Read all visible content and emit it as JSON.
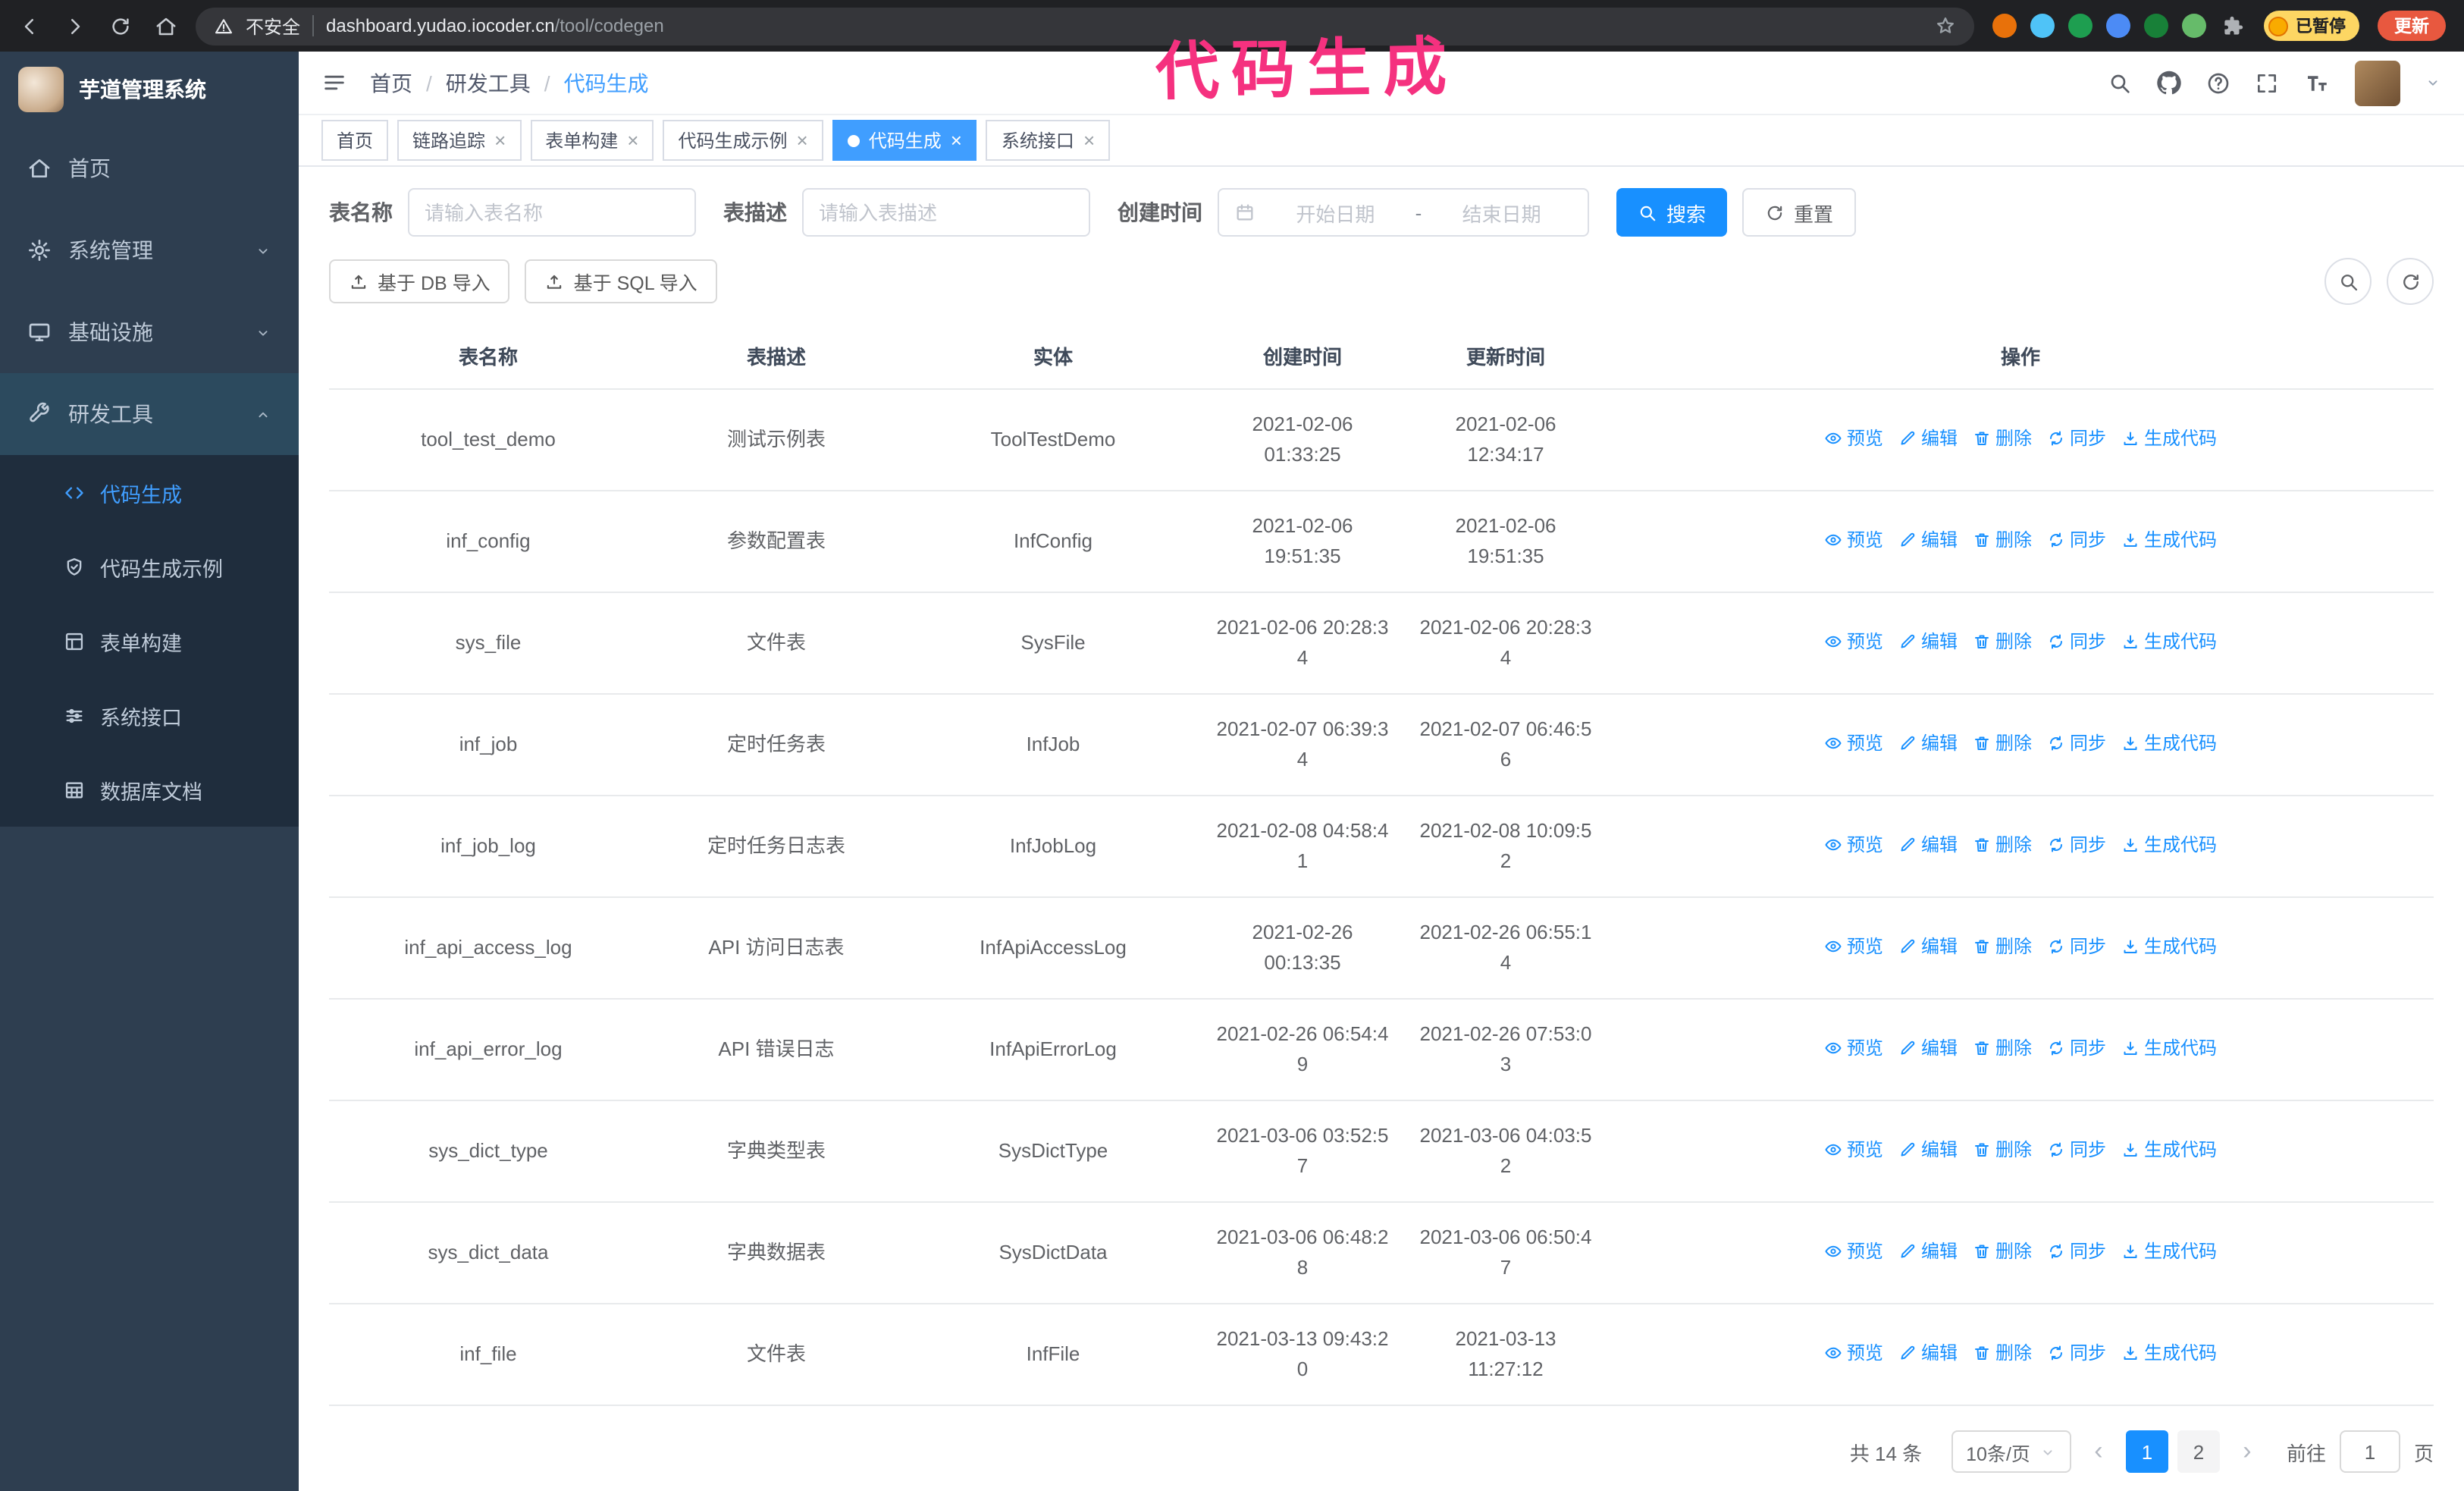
{
  "colors": {
    "primary": "#1890ff",
    "tab_active": "#409eff",
    "sidebar_bg": "#2e3e50",
    "submenu_bg": "#1f2d3d",
    "sidebar_active": "#409eff",
    "annotation": "#f5317f",
    "update_btn": "#e8583f",
    "paused_bg": "#fdd663"
  },
  "browser": {
    "security_label": "不安全",
    "url_host": "dashboard.yudao.iocoder.cn",
    "url_path": "/tool/codegen",
    "paused_badge": "已暂停",
    "update_button": "更新",
    "extensions": [
      {
        "name": "extension-icon",
        "type": "circle",
        "color": "#e8710a"
      },
      {
        "name": "extension-icon",
        "type": "circle",
        "color": "#4fc3f7"
      },
      {
        "name": "extension-icon",
        "type": "circle",
        "color": "#1e9e50"
      },
      {
        "name": "extension-icon",
        "type": "circle",
        "color": "#4c8bf5"
      },
      {
        "name": "extension-icon",
        "type": "circle",
        "color": "#188038"
      },
      {
        "name": "extension-icon",
        "type": "circle",
        "color": "#66bb6a"
      },
      {
        "name": "puzzle-extension-icon",
        "type": "puzzle",
        "color": "#aeb1b5"
      }
    ]
  },
  "annotation": {
    "text": "代码生成"
  },
  "sidebar": {
    "logo_title": "芋道管理系统",
    "items": [
      {
        "id": "home",
        "label": "首页",
        "icon": "home"
      },
      {
        "id": "system",
        "label": "系统管理",
        "icon": "gear",
        "chevron": "down"
      },
      {
        "id": "infra",
        "label": "基础设施",
        "icon": "monitor",
        "chevron": "down"
      },
      {
        "id": "devtools",
        "label": "研发工具",
        "icon": "tools",
        "chevron": "up",
        "expanded": true
      }
    ],
    "subitems": [
      {
        "id": "codegen",
        "label": "代码生成",
        "icon": "code",
        "active": true
      },
      {
        "id": "codegen-example",
        "label": "代码生成示例",
        "icon": "shield",
        "active": false
      },
      {
        "id": "form-builder",
        "label": "表单构建",
        "icon": "form",
        "active": false
      },
      {
        "id": "system-api",
        "label": "系统接口",
        "icon": "api",
        "active": false
      },
      {
        "id": "db-doc",
        "label": "数据库文档",
        "icon": "dbtable",
        "active": false
      }
    ]
  },
  "header": {
    "breadcrumb": [
      "首页",
      "研发工具",
      "代码生成"
    ]
  },
  "tabs": [
    {
      "id": "home",
      "label": "首页",
      "closable": false,
      "active": false
    },
    {
      "id": "tracer",
      "label": "链路追踪",
      "closable": true,
      "active": false
    },
    {
      "id": "form-builder",
      "label": "表单构建",
      "closable": true,
      "active": false
    },
    {
      "id": "codegen-example",
      "label": "代码生成示例",
      "closable": true,
      "active": false
    },
    {
      "id": "codegen",
      "label": "代码生成",
      "closable": true,
      "active": true
    },
    {
      "id": "system-api",
      "label": "系统接口",
      "closable": true,
      "active": false
    }
  ],
  "filters": {
    "table_name_label": "表名称",
    "table_name_placeholder": "请输入表名称",
    "table_desc_label": "表描述",
    "table_desc_placeholder": "请输入表描述",
    "create_time_label": "创建时间",
    "date_start_placeholder": "开始日期",
    "date_separator": "-",
    "date_end_placeholder": "结束日期",
    "search_button": "搜索",
    "reset_button": "重置"
  },
  "toolbar": {
    "import_db": "基于 DB 导入",
    "import_sql": "基于 SQL 导入"
  },
  "table": {
    "columns": [
      "表名称",
      "表描述",
      "实体",
      "创建时间",
      "更新时间",
      "操作"
    ],
    "actions": [
      {
        "id": "preview",
        "label": "预览",
        "icon": "eye"
      },
      {
        "id": "edit",
        "label": "编辑",
        "icon": "edit"
      },
      {
        "id": "delete",
        "label": "删除",
        "icon": "trash"
      },
      {
        "id": "sync",
        "label": "同步",
        "icon": "sync"
      },
      {
        "id": "generate",
        "label": "生成代码",
        "icon": "download"
      }
    ],
    "rows": [
      {
        "name": "tool_test_demo",
        "desc": "测试示例表",
        "entity": "ToolTestDemo",
        "created": "2021-02-06 01:33:25",
        "created_wrap": false,
        "updated": "2021-02-06 12:34:17",
        "updated_wrap": false
      },
      {
        "name": "inf_config",
        "desc": "参数配置表",
        "entity": "InfConfig",
        "created": "2021-02-06 19:51:35",
        "created_wrap": false,
        "updated": "2021-02-06 19:51:35",
        "updated_wrap": false
      },
      {
        "name": "sys_file",
        "desc": "文件表",
        "entity": "SysFile",
        "created": "2021-02-06 20:28:34",
        "created_wrap": true,
        "updated": "2021-02-06 20:28:34",
        "updated_wrap": true
      },
      {
        "name": "inf_job",
        "desc": "定时任务表",
        "entity": "InfJob",
        "created": "2021-02-07 06:39:34",
        "created_wrap": true,
        "updated": "2021-02-07 06:46:56",
        "updated_wrap": true
      },
      {
        "name": "inf_job_log",
        "desc": "定时任务日志表",
        "entity": "InfJobLog",
        "created": "2021-02-08 04:58:41",
        "created_wrap": true,
        "updated": "2021-02-08 10:09:52",
        "updated_wrap": true
      },
      {
        "name": "inf_api_access_log",
        "desc": "API 访问日志表",
        "entity": "InfApiAccessLog",
        "created": "2021-02-26 00:13:35",
        "created_wrap": false,
        "updated": "2021-02-26 06:55:14",
        "updated_wrap": true
      },
      {
        "name": "inf_api_error_log",
        "desc": "API 错误日志",
        "entity": "InfApiErrorLog",
        "created": "2021-02-26 06:54:49",
        "created_wrap": true,
        "updated": "2021-02-26 07:53:03",
        "updated_wrap": true
      },
      {
        "name": "sys_dict_type",
        "desc": "字典类型表",
        "entity": "SysDictType",
        "created": "2021-03-06 03:52:57",
        "created_wrap": true,
        "updated": "2021-03-06 04:03:52",
        "updated_wrap": true
      },
      {
        "name": "sys_dict_data",
        "desc": "字典数据表",
        "entity": "SysDictData",
        "created": "2021-03-06 06:48:28",
        "created_wrap": true,
        "updated": "2021-03-06 06:50:47",
        "updated_wrap": true
      },
      {
        "name": "inf_file",
        "desc": "文件表",
        "entity": "InfFile",
        "created": "2021-03-13 09:43:20",
        "created_wrap": true,
        "updated": "2021-03-13 11:27:12",
        "updated_wrap": false
      }
    ]
  },
  "pagination": {
    "total": "共 14 条",
    "page_size": "10条/页",
    "pages": [
      {
        "label": "1",
        "active": true
      },
      {
        "label": "2",
        "active": false
      }
    ],
    "goto_label": "前往",
    "goto_value": "1",
    "goto_suffix": "页"
  }
}
